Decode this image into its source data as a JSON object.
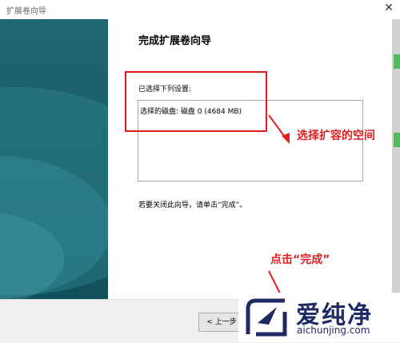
{
  "window": {
    "title": "扩展卷向导",
    "close_glyph": "✕"
  },
  "main": {
    "heading": "完成扩展卷向导",
    "settings_label": "已选择下列设置:",
    "settings": [
      "选择的磁盘: 磁盘 0 (4684 MB)"
    ],
    "finish_note": "若要关闭此向导，请单击“完成”。"
  },
  "buttons": {
    "back": "< 上一步"
  },
  "annotations": {
    "space_label": "选择扩容的空间",
    "click_label": "点击“完成”",
    "color": "#e02020"
  },
  "watermark": {
    "name": "爱纯净",
    "url": "aichunjing.com"
  }
}
